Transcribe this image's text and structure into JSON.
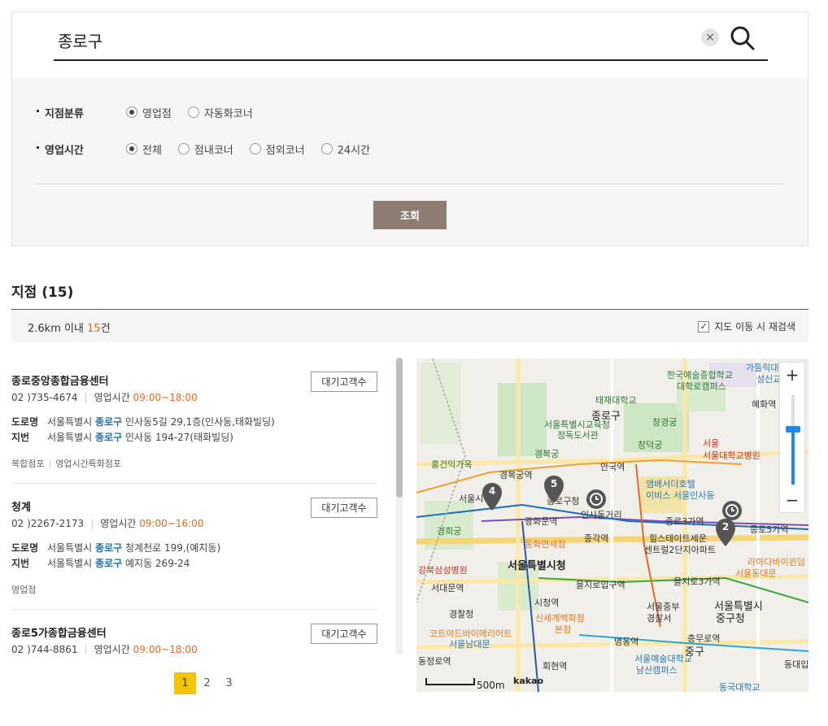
{
  "search": {
    "query": "종로구",
    "clear_icon": "×"
  },
  "filters": {
    "branch_type": {
      "label": "지점분류",
      "options": [
        "영업점",
        "자동화코너"
      ],
      "selected": "영업점"
    },
    "hours": {
      "label": "영업시간",
      "options": [
        "전체",
        "점내코너",
        "점외코너",
        "24시간"
      ],
      "selected": "전체"
    },
    "query_button": "조회"
  },
  "results": {
    "title": "지점 (15)",
    "distance_prefix": "2.6km 이내 ",
    "count": "15",
    "count_suffix": "건",
    "recheck_label": "지도 이동 시 재검색",
    "recheck_checked": true
  },
  "items": [
    {
      "name": "종로중앙종합금융센터",
      "tel": "02 )735-4674",
      "hours_label": "영업시간",
      "hours": "09:00~18:00",
      "wait_button": "대기고객수",
      "road_label": "도로명",
      "road_pre": "서울특별시",
      "road_kw": "종로구",
      "road_rest": "인사동5길 29,1층(인사동,태화빌딩)",
      "lot_label": "지번",
      "lot_pre": "서울특별시",
      "lot_kw": "종로구",
      "lot_rest": "인사동 194-27(태화빌딩)",
      "tag1": "복합점포",
      "tag2": "영업시간특화점포"
    },
    {
      "name": "청계",
      "tel": "02 )2267-2173",
      "hours_label": "영업시간",
      "hours": "09:00~16:00",
      "wait_button": "대기고객수",
      "road_label": "도로명",
      "road_pre": "서울특별시",
      "road_kw": "종로구",
      "road_rest": "청계천로 199,(예지동)",
      "lot_label": "지번",
      "lot_pre": "서울특별시",
      "lot_kw": "종로구",
      "lot_rest": "예지동 269-24",
      "tag1": "영업점",
      "tag2": ""
    },
    {
      "name": "종로5가종합금융센터",
      "tel": "02 )744-8861",
      "hours_label": "영업시간",
      "hours": "09:00~18:00",
      "wait_button": "대기고객수"
    }
  ],
  "pagination": {
    "pages": [
      "1",
      "2",
      "3"
    ],
    "current": "1"
  },
  "map": {
    "labels": {
      "l1": "한국예술종합학교",
      "l2": "대학로캠퍼스",
      "l3": "태재대학교",
      "l4": "종로구",
      "l5": "서울특별시교육청",
      "l6": "정독도서관",
      "l7": "창경궁",
      "l8": "서울대학교병원",
      "l9": "서울",
      "l10": "경복궁",
      "l11": "창덕궁",
      "l12": "홍건익가옥",
      "l13": "경복궁역",
      "l14": "안국역",
      "l15": "앰배서더호텔",
      "l16": "이비스 서울인사동",
      "l17": "종로구청",
      "l18": "인사동거리",
      "l19": "광화문역",
      "l20": "종로3가역",
      "l21": "종로5가역",
      "l22": "경희궁",
      "l23": "동화면세점",
      "l24": "종각역",
      "l25": "힐스테이트세운",
      "l26": "센트럴2단지아파트",
      "l27": "라마다바이윈덤",
      "l28": "서울동대문",
      "l29": "서울특별시청",
      "l30": "강북삼성병원",
      "l31": "서대문역",
      "l32": "을지로입구역",
      "l33": "을지로3가역",
      "l34": "시청역",
      "l35": "경찰청",
      "l36": "서울중부",
      "l37": "경찰서",
      "l38": "서울특별시",
      "l39": "중구청",
      "l40": "신세계백화점",
      "l41": "본점",
      "l42": "코트야드바이메리어트",
      "l43": "서울남대문",
      "l44": "충무로역",
      "l45": "중구",
      "l46": "명동역",
      "l47": "회현역",
      "l48": "서울예술대학교",
      "l49": "남산캠퍼스",
      "l50": "동대입",
      "l51": "동국대학교",
      "l52": "혜화역",
      "l53": "가톨릭대",
      "l54": "성신교",
      "l55": "서울시청",
      "l56": "동정로역"
    },
    "pins": [
      "4",
      "5",
      "2"
    ],
    "scale_label": "500m",
    "brand": "kakao",
    "zoom_in": "+",
    "zoom_out": "−"
  }
}
